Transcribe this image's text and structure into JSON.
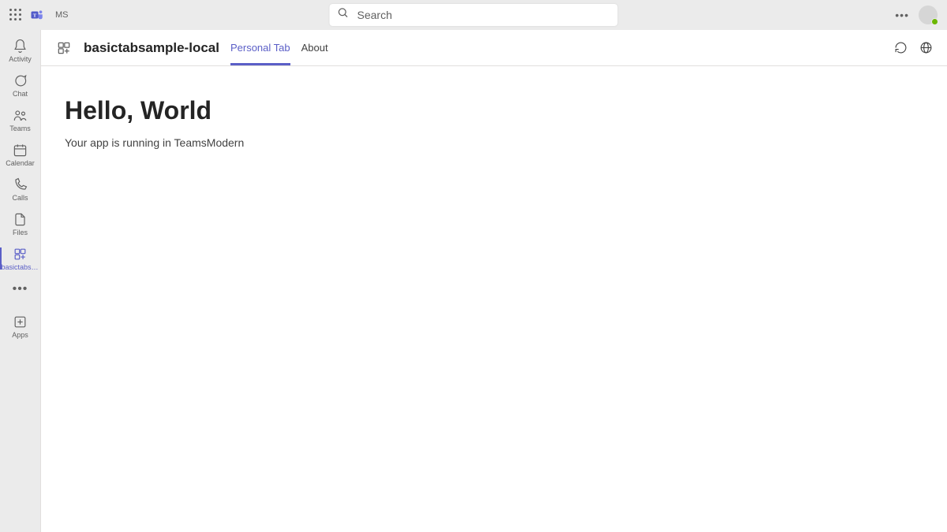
{
  "topbar": {
    "user_initials": "MS",
    "search_placeholder": "Search"
  },
  "leftrail": {
    "items": [
      {
        "label": "Activity",
        "icon": "bell"
      },
      {
        "label": "Chat",
        "icon": "chat"
      },
      {
        "label": "Teams",
        "icon": "teams"
      },
      {
        "label": "Calendar",
        "icon": "calendar"
      },
      {
        "label": "Calls",
        "icon": "calls"
      },
      {
        "label": "Files",
        "icon": "files"
      },
      {
        "label": "basictabsa...",
        "icon": "app",
        "active": true
      }
    ],
    "apps_label": "Apps"
  },
  "app_header": {
    "title": "basictabsample-local",
    "tabs": [
      {
        "label": "Personal Tab",
        "active": true
      },
      {
        "label": "About",
        "active": false
      }
    ]
  },
  "content": {
    "heading": "Hello, World",
    "text": "Your app is running in TeamsModern"
  }
}
